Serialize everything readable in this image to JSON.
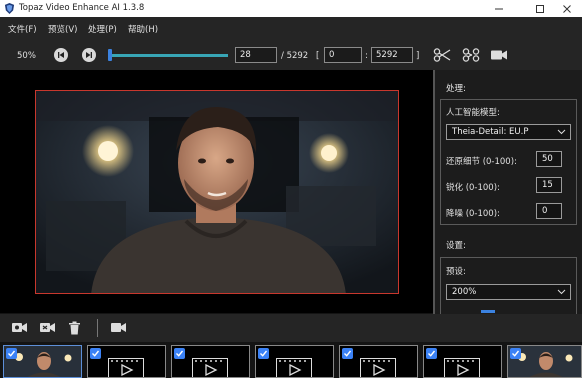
{
  "window": {
    "title": "Topaz Video Enhance AI 1.3.8",
    "app_icon": "topaz-shield-icon",
    "controls": [
      "minimize-icon",
      "maximize-icon",
      "close-icon"
    ]
  },
  "menu": {
    "items": [
      "文件(F)",
      "预览(V)",
      "处理(P)",
      "帮助(H)"
    ]
  },
  "controls": {
    "zoom": "50%",
    "current_frame": "28",
    "total_frames": "/ 5292",
    "range_open": "[",
    "range_start": "0",
    "range_sep": ":",
    "range_end": "5292",
    "range_close": "]",
    "timeline_progress": 0.0053,
    "icons": [
      "skip-back-icon",
      "play-next-icon",
      "scissors-icon",
      "split-scissors-icon",
      "video-camera-icon"
    ]
  },
  "panel": {
    "processing_heading": "处理:",
    "ai_model_label": "人工智能模型:",
    "ai_model_value": "Theia-Detail: EU.P",
    "restore_label": "还原细节 (0-100):",
    "restore_value": "50",
    "sharpen_label": "锐化 (0-100):",
    "sharpen_value": "15",
    "denoise_label": "降噪 (0-100):",
    "denoise_value": "0",
    "settings_heading": "设置:",
    "preset_label": "预设:",
    "preset_value": "200%"
  },
  "bottom_toolbar": {
    "icons": [
      "add-video-icon",
      "import-video-icon",
      "trash-icon",
      "export-video-icon"
    ]
  },
  "thumbnails": [
    {
      "checked": true,
      "kind": "frame"
    },
    {
      "checked": true,
      "kind": "placeholder"
    },
    {
      "checked": true,
      "kind": "placeholder"
    },
    {
      "checked": true,
      "kind": "placeholder"
    },
    {
      "checked": true,
      "kind": "placeholder"
    },
    {
      "checked": true,
      "kind": "placeholder"
    },
    {
      "checked": true,
      "kind": "frame"
    }
  ],
  "colors": {
    "accent": "#3b82e0",
    "slider": "#38a6b6",
    "frame_border": "#c8372d"
  }
}
